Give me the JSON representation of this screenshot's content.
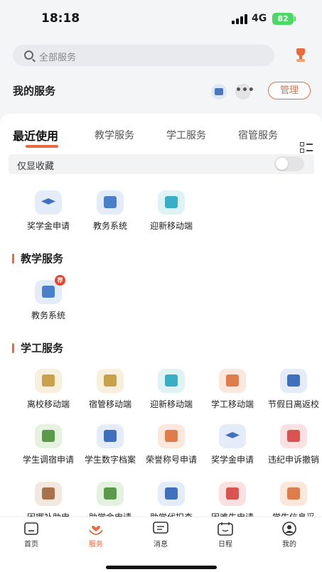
{
  "status_bar": {
    "time": "18:18",
    "network": "4G",
    "battery": "82"
  },
  "search": {
    "placeholder": "全部服务"
  },
  "my_services": {
    "title": "我的服务",
    "more_label": "•••",
    "manage_label": "管理"
  },
  "tabs": [
    {
      "label": "最近使用",
      "active": true
    },
    {
      "label": "教学服务",
      "active": false
    },
    {
      "label": "学工服务",
      "active": false
    },
    {
      "label": "宿管服务",
      "active": false
    }
  ],
  "favorites_only": {
    "label": "仅显收藏",
    "on": false
  },
  "recent": [
    {
      "label": "奖学金申请",
      "icon": "graduation-cap-icon",
      "bg": "#e3ecf8",
      "fg": "#3f6fbf"
    },
    {
      "label": "教务系统",
      "icon": "map-book-icon",
      "bg": "#e3ecf8",
      "fg": "#4a7fc9"
    },
    {
      "label": "迎新移动端",
      "icon": "welcome-card-icon",
      "bg": "#dff2f4",
      "fg": "#3aaec4"
    }
  ],
  "teaching": {
    "title": "教学服务",
    "items": [
      {
        "label": "教务系统",
        "icon": "map-book-icon",
        "badge": "荐",
        "bg": "#e3ecf8",
        "fg": "#4a7fc9"
      }
    ]
  },
  "student_affairs": {
    "title": "学工服务",
    "items": [
      {
        "label": "离校移动端",
        "icon": "leave-school-icon",
        "bg": "#f8f0dc",
        "fg": "#c9a14a"
      },
      {
        "label": "宿管移动端",
        "icon": "dormitory-icon",
        "bg": "#f8f0dc",
        "fg": "#c9a14a"
      },
      {
        "label": "迎新移动端",
        "icon": "welcome-card-icon",
        "bg": "#dff2f4",
        "fg": "#3aaec4"
      },
      {
        "label": "学工移动端",
        "icon": "student-card-icon",
        "bg": "#fbe7dc",
        "fg": "#e07c4a"
      },
      {
        "label": "节假日离返校",
        "icon": "holiday-icon",
        "bg": "#e3ecf8",
        "fg": "#3f6fbf"
      },
      {
        "label": "学生调宿申请",
        "icon": "edit-doc-icon",
        "bg": "#e6f2e0",
        "fg": "#5a9b4a"
      },
      {
        "label": "学生数字档案",
        "icon": "archive-icon",
        "bg": "#e3ecf8",
        "fg": "#3f6fbf"
      },
      {
        "label": "荣誉称号申请",
        "icon": "medal-icon",
        "bg": "#fbe7dc",
        "fg": "#e07c4a"
      },
      {
        "label": "奖学金申请",
        "icon": "graduation-cap-icon",
        "bg": "#e3ecf8",
        "fg": "#3f6fbf"
      },
      {
        "label": "违纪申诉撤销",
        "icon": "warning-icon",
        "bg": "#f9e1e1",
        "fg": "#d9534f"
      },
      {
        "label": "困哪补助申",
        "icon": "aid-form-icon",
        "bg": "#f3e8df",
        "fg": "#a8714a"
      },
      {
        "label": "助学金申请",
        "icon": "grant-icon",
        "bg": "#e6f2e0",
        "fg": "#5a9b4a"
      },
      {
        "label": "助学代扣查",
        "icon": "deduct-icon",
        "bg": "#e3ecf8",
        "fg": "#3f6fbf"
      },
      {
        "label": "困难生申请",
        "icon": "hardship-icon",
        "bg": "#f9e1e1",
        "fg": "#d9534f"
      },
      {
        "label": "学生信息采",
        "icon": "info-collect-icon",
        "bg": "#fbe7dc",
        "fg": "#e07c4a"
      }
    ]
  },
  "bottom_nav": [
    {
      "label": "首页",
      "icon": "home-icon",
      "active": false
    },
    {
      "label": "服务",
      "icon": "heart-hands-icon",
      "active": true
    },
    {
      "label": "消息",
      "icon": "message-icon",
      "active": false
    },
    {
      "label": "日程",
      "icon": "calendar-icon",
      "active": false
    },
    {
      "label": "我的",
      "icon": "profile-icon",
      "active": false
    }
  ]
}
